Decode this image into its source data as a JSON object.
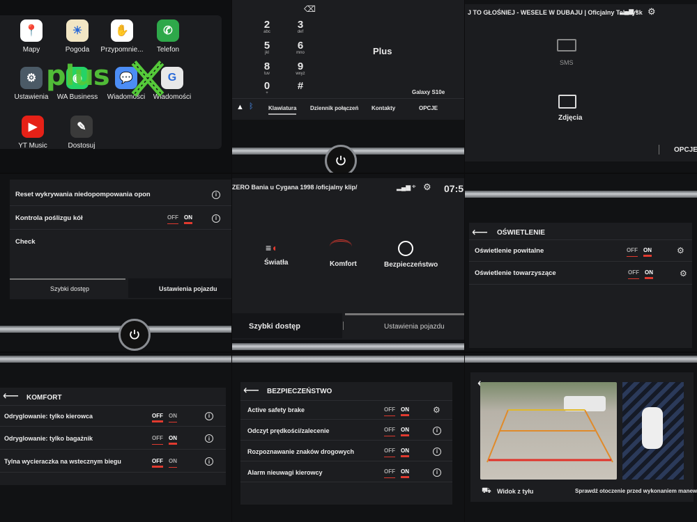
{
  "launcher": {
    "apps": [
      {
        "label": "Mapy",
        "icon": "maps-icon",
        "color": "#ffffff",
        "glyph": "📍"
      },
      {
        "label": "Pogoda",
        "icon": "weather-icon",
        "color": "#f2e6c4",
        "glyph": "☀"
      },
      {
        "label": "Przypomnie...",
        "icon": "reminder-icon",
        "color": "#ffffff",
        "glyph": "✋"
      },
      {
        "label": "Telefon",
        "icon": "phone-icon",
        "color": "#2ea84a",
        "glyph": "✆"
      },
      {
        "label": "Ustawienia",
        "icon": "settings-icon",
        "color": "#4b5a66",
        "glyph": "⚙"
      },
      {
        "label": "WA Business",
        "icon": "whatsapp-icon",
        "color": "#25d366",
        "glyph": "◉"
      },
      {
        "label": "Wiadomości",
        "icon": "messages-icon",
        "color": "#4c8df5",
        "glyph": "💬"
      },
      {
        "label": "Wiadomości",
        "icon": "google-messages-icon",
        "color": "#e8e8e8",
        "glyph": "G"
      },
      {
        "label": "YT Music",
        "icon": "yt-music-icon",
        "color": "#e62117",
        "glyph": "▶"
      },
      {
        "label": "Dostosuj",
        "icon": "pencil-icon",
        "color": "#3a3a3a",
        "glyph": "✎"
      }
    ],
    "logo_text": "plus"
  },
  "dialer": {
    "keys": [
      {
        "num": "2",
        "sub": "abc"
      },
      {
        "num": "3",
        "sub": "def"
      },
      {
        "num": "5",
        "sub": "jkl"
      },
      {
        "num": "6",
        "sub": "mno"
      },
      {
        "num": "8",
        "sub": "tuv"
      },
      {
        "num": "9",
        "sub": "wxyz"
      },
      {
        "num": "0",
        "sub": "+"
      },
      {
        "num": "#",
        "sub": ""
      }
    ],
    "carrier": "Plus",
    "device": "Galaxy S10e",
    "tabs": [
      "Klawiatura",
      "Dziennik połączeń",
      "Kontakty",
      "OPCJE"
    ]
  },
  "media": {
    "ticker": "J TO GŁOŚNIEJ - WESELE W DUBAJU | Oficjalny Teledysk",
    "sms": "SMS",
    "photos": "Zdjęcia",
    "options": "OPCJE"
  },
  "vehicle1": {
    "rows": [
      {
        "label": "Reset wykrywania niedopompowania opon"
      },
      {
        "label": "Kontrola poślizgu kół",
        "off": "OFF",
        "on": "ON"
      },
      {
        "label": "Check"
      }
    ],
    "tabs": [
      "Szybki dostęp",
      "Ustawienia pojazdu"
    ]
  },
  "home": {
    "ticker": "ZERO Bania u Cygana 1998 /oficjalny klip/",
    "time": "07:5",
    "items": [
      "Światła",
      "Komfort",
      "Bezpieczeństwo"
    ],
    "tabs": [
      "Szybki dostęp",
      "Ustawienia pojazdu"
    ]
  },
  "lighting": {
    "title": "OŚWIETLENIE",
    "rows": [
      {
        "label": "Oświetlenie powitalne",
        "off": "OFF",
        "on": "ON"
      },
      {
        "label": "Oświetlenie towarzyszące",
        "off": "OFF",
        "on": "ON"
      }
    ]
  },
  "comfort": {
    "title": "KOMFORT",
    "rows": [
      {
        "label": "Odryglowanie: tylko kierowca",
        "off": "OFF",
        "on": "ON",
        "state": "off"
      },
      {
        "label": "Odryglowanie: tylko bagażnik",
        "off": "OFF",
        "on": "ON",
        "state": "on"
      },
      {
        "label": "Tylna wycieraczka na wstecznym biegu",
        "off": "OFF",
        "on": "ON",
        "state": "off"
      }
    ]
  },
  "safety": {
    "title": "BEZPIECZEŃSTWO",
    "rows": [
      {
        "label": "Active safety brake",
        "off": "OFF",
        "on": "ON"
      },
      {
        "label": "Odczyt prędkości/zalecenie",
        "off": "OFF",
        "on": "ON"
      },
      {
        "label": "Rozpoznawanie znaków drogowych",
        "off": "OFF",
        "on": "ON"
      },
      {
        "label": "Alarm nieuwagi kierowcy",
        "off": "OFF",
        "on": "ON"
      }
    ]
  },
  "camera": {
    "view": "Widok z tyłu",
    "hint": "Sprawdź otoczenie przed wykonaniem manewru"
  }
}
